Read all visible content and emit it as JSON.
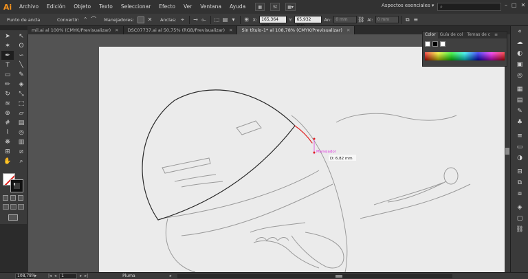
{
  "app": {
    "logo": "Ai"
  },
  "menu": [
    "Archivo",
    "Edición",
    "Objeto",
    "Texto",
    "Seleccionar",
    "Efecto",
    "Ver",
    "Ventana",
    "Ayuda"
  ],
  "menubar_badge": "St",
  "workspace": "Aspectos esenciales",
  "search": {
    "placeholder": ""
  },
  "window_buttons": [
    "–",
    "□",
    "✕"
  ],
  "controlbar": {
    "anchor_label": "Punto de ancla",
    "convert_label": "Convertir:",
    "handles_label": "Manejadores:",
    "anchors_label": "Anclas:",
    "x_label": "X:",
    "x_value": "165,364 mm",
    "y_label": "Y:",
    "y_value": "65,932 mm",
    "w_label": "An:",
    "w_value": "0 mm",
    "h_label": "Al:",
    "h_value": "0 mm"
  },
  "tabs": [
    {
      "label": "mil.ai al 100% (CMYK/Previsualizar)",
      "active": false
    },
    {
      "label": "DSC07737.ai al 50,75% (RGB/Previsualizar)",
      "active": false
    },
    {
      "label": "Sin título-1* al 108,78% (CMYK/Previsualizar)",
      "active": true
    }
  ],
  "tools": [
    {
      "name": "selection-tool",
      "glyph": "➤"
    },
    {
      "name": "direct-selection-tool",
      "glyph": "↖"
    },
    {
      "name": "magic-wand-tool",
      "glyph": "✶"
    },
    {
      "name": "lasso-tool",
      "glyph": "ʘ"
    },
    {
      "name": "pen-tool",
      "glyph": "✒"
    },
    {
      "name": "curvature-tool",
      "glyph": "∽"
    },
    {
      "name": "type-tool",
      "glyph": "T"
    },
    {
      "name": "line-tool",
      "glyph": "╲"
    },
    {
      "name": "rectangle-tool",
      "glyph": "▭"
    },
    {
      "name": "paintbrush-tool",
      "glyph": "✎"
    },
    {
      "name": "pencil-tool",
      "glyph": "✏"
    },
    {
      "name": "eraser-tool",
      "glyph": "◈"
    },
    {
      "name": "rotate-tool",
      "glyph": "↻"
    },
    {
      "name": "scale-tool",
      "glyph": "⤡"
    },
    {
      "name": "width-tool",
      "glyph": "≋"
    },
    {
      "name": "free-transform-tool",
      "glyph": "⬚"
    },
    {
      "name": "shape-builder-tool",
      "glyph": "⊕"
    },
    {
      "name": "perspective-tool",
      "glyph": "▱"
    },
    {
      "name": "mesh-tool",
      "glyph": "#"
    },
    {
      "name": "gradient-tool",
      "glyph": "▤"
    },
    {
      "name": "eyedropper-tool",
      "glyph": "⌇"
    },
    {
      "name": "blend-tool",
      "glyph": "◎"
    },
    {
      "name": "symbol-sprayer-tool",
      "glyph": "❋"
    },
    {
      "name": "column-graph-tool",
      "glyph": "▥"
    },
    {
      "name": "artboard-tool",
      "glyph": "⊞"
    },
    {
      "name": "slice-tool",
      "glyph": "⧄"
    },
    {
      "name": "hand-tool",
      "glyph": "✋"
    },
    {
      "name": "zoom-tool",
      "glyph": "⌕"
    }
  ],
  "color_panel": {
    "tabs": [
      "Color",
      "Guía de col",
      "Temas de c"
    ],
    "accent_fill": "#ffffff",
    "accent_stroke": "#000000"
  },
  "canvas": {
    "smart_guide_label": "Manejador",
    "measure_label": "D: 6.82 mm",
    "stroke_color": "#2a2a2a",
    "highlight_color": "#e02020",
    "guide_color": "#e040e0"
  },
  "statusbar": {
    "zoom": "108,78%",
    "artboard": "1",
    "tool": "Pluma"
  },
  "dock_icons": [
    "libraries-icon",
    "color-icon",
    "color-guide-icon",
    "appearance-icon",
    "graphic-styles-icon",
    "swatches-icon",
    "brushes-icon",
    "symbols-icon",
    "stroke-icon",
    "gradient-icon",
    "transparency-icon",
    "align-icon",
    "transform-icon",
    "pathfinder-icon",
    "layers-icon",
    "artboards-icon",
    "links-icon"
  ]
}
